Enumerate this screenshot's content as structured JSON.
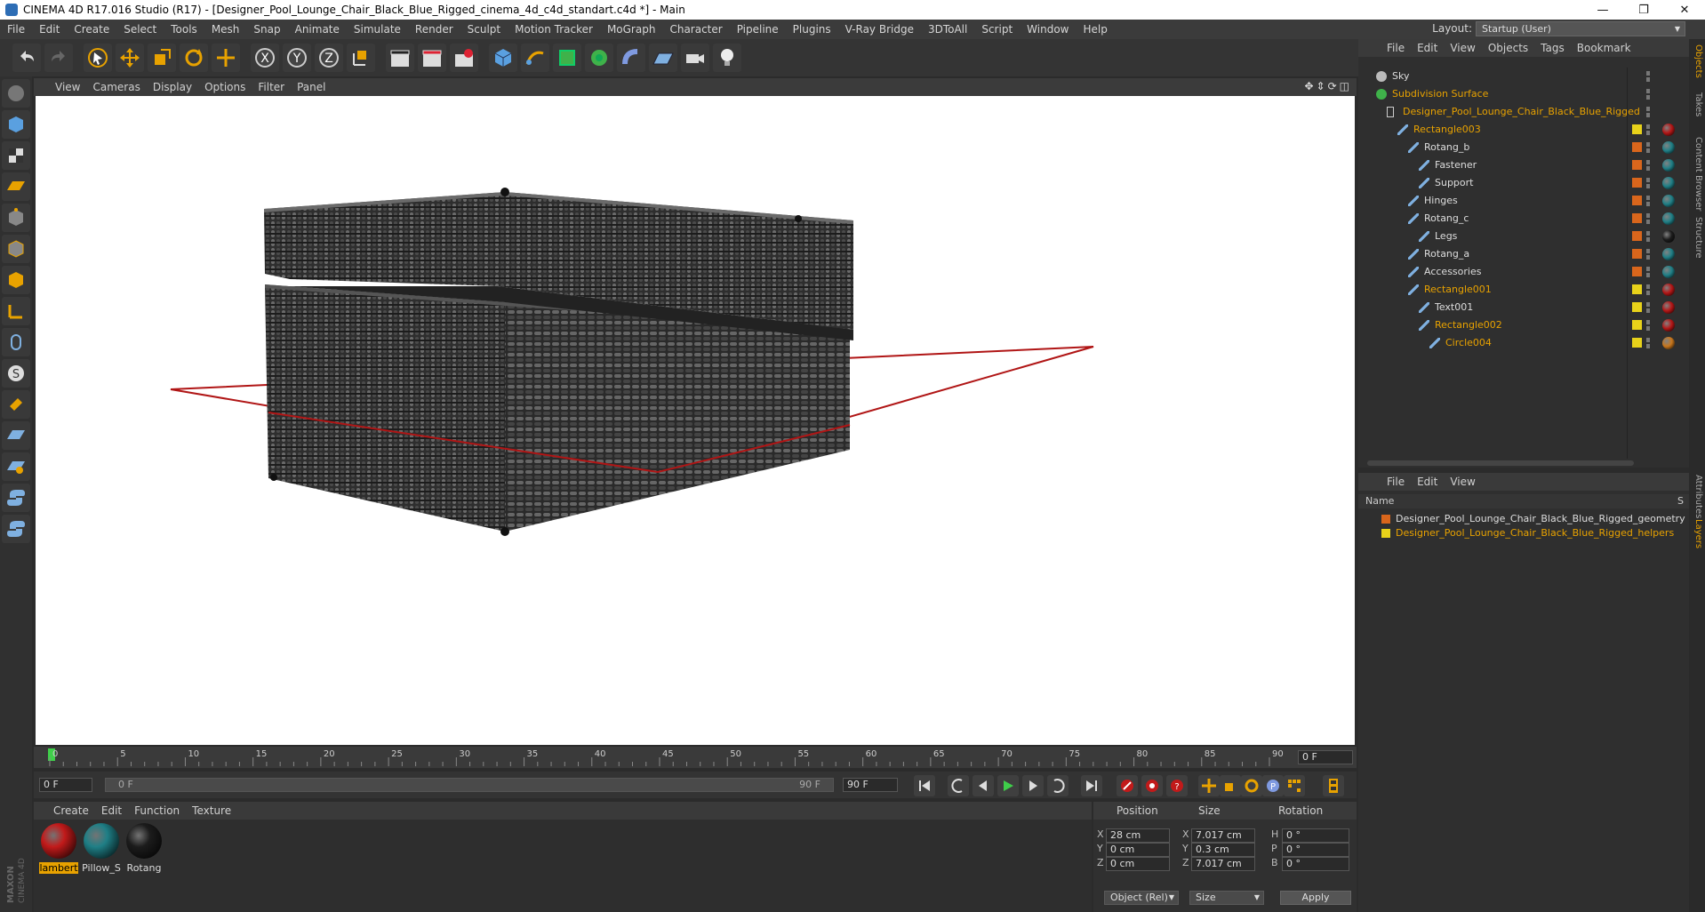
{
  "window": {
    "title": "CINEMA 4D R17.016 Studio (R17) - [Designer_Pool_Lounge_Chair_Black_Blue_Rigged_cinema_4d_c4d_standart.c4d *] - Main",
    "minimize": "—",
    "restore": "❐",
    "close": "✕"
  },
  "menubar": {
    "items": [
      "File",
      "Edit",
      "Create",
      "Select",
      "Tools",
      "Mesh",
      "Snap",
      "Animate",
      "Simulate",
      "Render",
      "Sculpt",
      "Motion Tracker",
      "MoGraph",
      "Character",
      "Pipeline",
      "Plugins",
      "V-Ray Bridge",
      "3DToAll",
      "Script",
      "Window",
      "Help"
    ],
    "layout_label": "Layout:",
    "layout_value": "Startup (User)"
  },
  "viewport": {
    "menu": [
      "View",
      "Cameras",
      "Display",
      "Options",
      "Filter",
      "Panel"
    ],
    "nav_icons": [
      "move-view-icon",
      "zoom-view-icon",
      "rotate-view-icon",
      "toggle-view-icon"
    ]
  },
  "timeline": {
    "ticks": [
      "0",
      "5",
      "10",
      "15",
      "20",
      "25",
      "30",
      "35",
      "40",
      "45",
      "50",
      "55",
      "60",
      "65",
      "70",
      "75",
      "80",
      "85",
      "90"
    ],
    "current_frame_box": "0 F",
    "start_field": "0 F",
    "range_start": "0 F",
    "range_end": "90 F",
    "end_field": "90 F"
  },
  "materials": {
    "menu": [
      "Create",
      "Edit",
      "Function",
      "Texture"
    ],
    "items": [
      {
        "label": "lambert",
        "color": "#c21a1a",
        "selected": true
      },
      {
        "label": "Pillow_S",
        "color": "#1f7f86",
        "selected": false
      },
      {
        "label": "Rotang",
        "color": "#1c1c1c",
        "selected": false
      }
    ]
  },
  "coordinates": {
    "headers": {
      "position": "Position",
      "size": "Size",
      "rotation": "Rotation"
    },
    "rows": [
      {
        "axis": "X",
        "pos": "28 cm",
        "size_axis": "X",
        "size": "7.017 cm",
        "rot_axis": "H",
        "rot": "0 °"
      },
      {
        "axis": "Y",
        "pos": "0 cm",
        "size_axis": "Y",
        "size": "0.3 cm",
        "rot_axis": "P",
        "rot": "0 °"
      },
      {
        "axis": "Z",
        "pos": "0 cm",
        "size_axis": "Z",
        "size": "7.017 cm",
        "rot_axis": "B",
        "rot": "0 °"
      }
    ],
    "mode_select": "Object (Rel)",
    "size_select": "Size",
    "apply": "Apply"
  },
  "objects": {
    "menu": [
      "File",
      "Edit",
      "View",
      "Objects",
      "Tags",
      "Bookmark"
    ],
    "rows": [
      {
        "name": "Sky",
        "depth": 0,
        "highlight": false,
        "icon": "sky-icon",
        "tag1": "",
        "tag2": ""
      },
      {
        "name": "Subdivision Surface",
        "depth": 0,
        "highlight": true,
        "icon": "subdivision-icon",
        "tag1": "",
        "tag2": ""
      },
      {
        "name": "Designer_Pool_Lounge_Chair_Black_Blue_Rigged",
        "depth": 1,
        "highlight": true,
        "icon": "null-icon",
        "tag1": "",
        "tag2": ""
      },
      {
        "name": "Rectangle003",
        "depth": 2,
        "highlight": true,
        "icon": "spline-icon",
        "tag1": "#e8d21a",
        "tag2": "#b41616"
      },
      {
        "name": "Rotang_b",
        "depth": 3,
        "highlight": false,
        "icon": "spline-icon",
        "tag1": "#d9661c",
        "tag2": "#1f7f86"
      },
      {
        "name": "Fastener",
        "depth": 4,
        "highlight": false,
        "icon": "spline-icon",
        "tag1": "#d9661c",
        "tag2": "#1f7f86"
      },
      {
        "name": "Support",
        "depth": 4,
        "highlight": false,
        "icon": "spline-icon",
        "tag1": "#d9661c",
        "tag2": "#1f7f86"
      },
      {
        "name": "Hinges",
        "depth": 3,
        "highlight": false,
        "icon": "spline-icon",
        "tag1": "#d9661c",
        "tag2": "#1f7f86"
      },
      {
        "name": "Rotang_c",
        "depth": 3,
        "highlight": false,
        "icon": "spline-icon",
        "tag1": "#d9661c",
        "tag2": "#1f7f86"
      },
      {
        "name": "Legs",
        "depth": 4,
        "highlight": false,
        "icon": "spline-icon",
        "tag1": "#d9661c",
        "tag2": "#1c1c1c"
      },
      {
        "name": "Rotang_a",
        "depth": 3,
        "highlight": false,
        "icon": "spline-icon",
        "tag1": "#d9661c",
        "tag2": "#1f7f86"
      },
      {
        "name": "Accessories",
        "depth": 3,
        "highlight": false,
        "icon": "spline-icon",
        "tag1": "#d9661c",
        "tag2": "#1f7f86"
      },
      {
        "name": "Rectangle001",
        "depth": 3,
        "highlight": true,
        "icon": "spline-icon",
        "tag1": "#e8d21a",
        "tag2": "#b41616"
      },
      {
        "name": "Text001",
        "depth": 4,
        "highlight": false,
        "icon": "spline-icon",
        "tag1": "#e8d21a",
        "tag2": "#b41616"
      },
      {
        "name": "Rectangle002",
        "depth": 4,
        "highlight": true,
        "icon": "spline-icon",
        "tag1": "#e8d21a",
        "tag2": "#b41616"
      },
      {
        "name": "Circle004",
        "depth": 5,
        "highlight": true,
        "icon": "spline-icon",
        "tag1": "#e8d21a",
        "tag2": "#c8761c"
      }
    ]
  },
  "layers": {
    "menu": [
      "File",
      "Edit",
      "View"
    ],
    "header_name": "Name",
    "header_s": "S",
    "rows": [
      {
        "name": "Designer_Pool_Lounge_Chair_Black_Blue_Rigged_geometry",
        "color": "#d9661c",
        "highlight": false
      },
      {
        "name": "Designer_Pool_Lounge_Chair_Black_Blue_Rigged_helpers",
        "color": "#e8d21a",
        "highlight": true
      }
    ]
  },
  "right_tabs": [
    "Objects",
    "Takes",
    "Content Browser",
    "Structure",
    "Attributes",
    "Layers"
  ],
  "branding": {
    "logo_text": "MAXON CINEMA 4D"
  }
}
